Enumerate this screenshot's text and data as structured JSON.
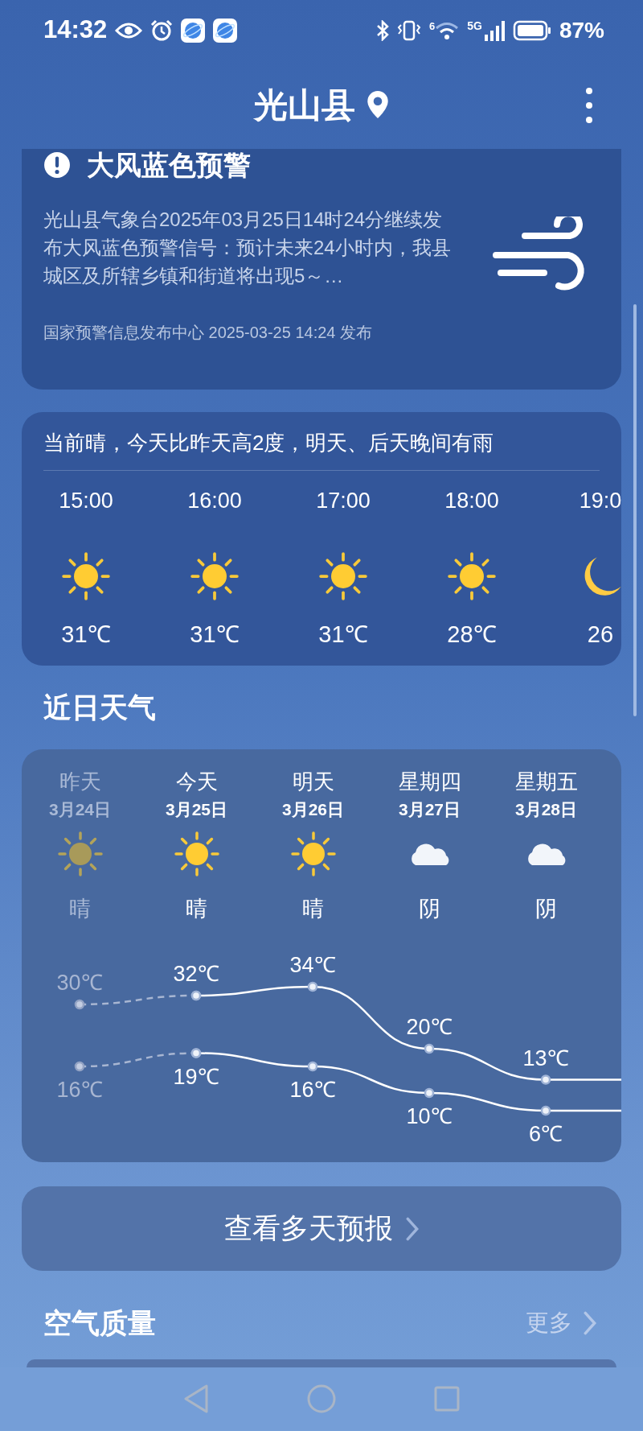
{
  "status_bar": {
    "time": "14:32",
    "wifi_label": "6",
    "network": "5G",
    "battery": "87%"
  },
  "header": {
    "title": "光山县"
  },
  "alert": {
    "title": "大风蓝色预警",
    "body": "光山县气象台2025年03月25日14时24分继续发布大风蓝色预警信号：预计未来24小时内，我县城区及所辖乡镇和街道将出现5～…",
    "source": "国家预警信息发布中心 2025-03-25 14:24 发布"
  },
  "hourly": {
    "summary": "当前晴，今天比昨天高2度，明天、后天晚间有雨",
    "hours": [
      {
        "time": "15:00",
        "kind": "sun",
        "temp": "31℃"
      },
      {
        "time": "16:00",
        "kind": "sun",
        "temp": "31℃"
      },
      {
        "time": "17:00",
        "kind": "sun",
        "temp": "31℃"
      },
      {
        "time": "18:00",
        "kind": "sun",
        "temp": "28℃"
      },
      {
        "time": "19:0",
        "kind": "moon",
        "temp": "26"
      }
    ]
  },
  "recent": {
    "title": "近日天气",
    "days": [
      {
        "weekday": "昨天",
        "date": "3月24日",
        "kind": "sun",
        "condition": "晴",
        "past": true
      },
      {
        "weekday": "今天",
        "date": "3月25日",
        "kind": "sun",
        "condition": "晴",
        "past": false
      },
      {
        "weekday": "明天",
        "date": "3月26日",
        "kind": "sun",
        "condition": "晴",
        "past": false
      },
      {
        "weekday": "星期四",
        "date": "3月27日",
        "kind": "cloud",
        "condition": "阴",
        "past": false
      },
      {
        "weekday": "星期五",
        "date": "3月28日",
        "kind": "cloud",
        "condition": "阴",
        "past": false
      }
    ],
    "chart_data": {
      "type": "line",
      "data_labels": true,
      "series": [
        {
          "color": "#a8b6d2",
          "line_style": "dashed",
          "marker": "circle",
          "values": [
            30,
            32,
            null,
            null,
            null
          ],
          "value_labels": [
            "30℃",
            null,
            null,
            null,
            null
          ]
        },
        {
          "color": "#ffffff",
          "line_style": "solid",
          "marker": "circle",
          "values": [
            null,
            32,
            34,
            20,
            13
          ],
          "value_labels": [
            null,
            "32℃",
            "34℃",
            "20℃",
            "13℃"
          ]
        },
        {
          "color": "#a8b6d2",
          "line_style": "dashed",
          "marker": "circle",
          "values": [
            16,
            19,
            null,
            null,
            null
          ],
          "value_labels": [
            "16℃",
            null,
            null,
            null,
            null
          ]
        },
        {
          "color": "#ffffff",
          "line_style": "solid",
          "marker": "circle",
          "values": [
            null,
            19,
            16,
            10,
            6
          ],
          "value_labels": [
            null,
            "19℃",
            "16℃",
            "10℃",
            "6℃"
          ]
        }
      ]
    }
  },
  "forecast_button": "查看多天预报",
  "air_quality": {
    "title": "空气质量",
    "more": "更多"
  }
}
